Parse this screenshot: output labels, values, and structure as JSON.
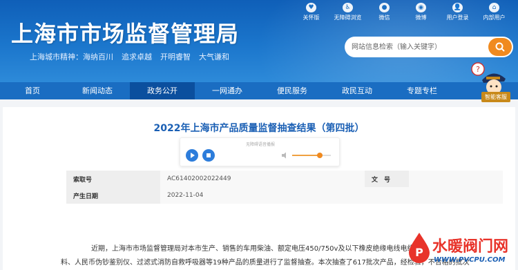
{
  "header": {
    "site_title": "上海市市场监督管理局",
    "spirit_items": [
      "上海城市精神：海纳百川",
      "追求卓越",
      "开明睿智",
      "大气谦和"
    ],
    "top_links": [
      {
        "label": "关怀版",
        "icon": "care-icon"
      },
      {
        "label": "无障碍浏览",
        "icon": "accessibility-icon"
      },
      {
        "label": "微信",
        "icon": "wechat-icon"
      },
      {
        "label": "微博",
        "icon": "weibo-icon"
      },
      {
        "label": "用户登录",
        "icon": "user-icon"
      },
      {
        "label": "内部用户",
        "icon": "internal-user-icon"
      }
    ],
    "search_placeholder": "网站信息检索（输入关键字）"
  },
  "nav": {
    "items": [
      "首页",
      "新闻动态",
      "政务公开",
      "一网通办",
      "便民服务",
      "政民互动",
      "专题专栏"
    ],
    "active_index": 2
  },
  "assistant": {
    "label": "智能客服"
  },
  "article": {
    "title": "2022年上海市产品质量监督抽查结果（第四批）",
    "player": {
      "caption": "无障碍语音播报",
      "volume": 0.72
    },
    "meta": {
      "index_label": "索取号",
      "index_value": "AC61402002022449",
      "doc_label": "文　号",
      "doc_value": "",
      "date_label": "产生日期",
      "date_value": "2022-11-04"
    },
    "body_lines": [
      "近期，上海市市场监督管理局对本市生产、销售的车用柴油、额定电压450/750v及以下橡皮绝缘电线电缆",
      "料、人民币伪钞鉴别仪、过滤式消防自救呼吸器等19种产品的质量进行了监督抽查。本次抽查了617批次产品，经检验，不合格的批次"
    ]
  },
  "watermark": {
    "text": "水暖阀门网",
    "url": "WWW.PVCPU.COM"
  },
  "colors": {
    "header_blue": "#1b76cc",
    "nav_blue": "#1a6dc2",
    "nav_active": "#0b4f9e",
    "title_blue": "#1a5fb4",
    "search_orange": "#f08a1f"
  }
}
